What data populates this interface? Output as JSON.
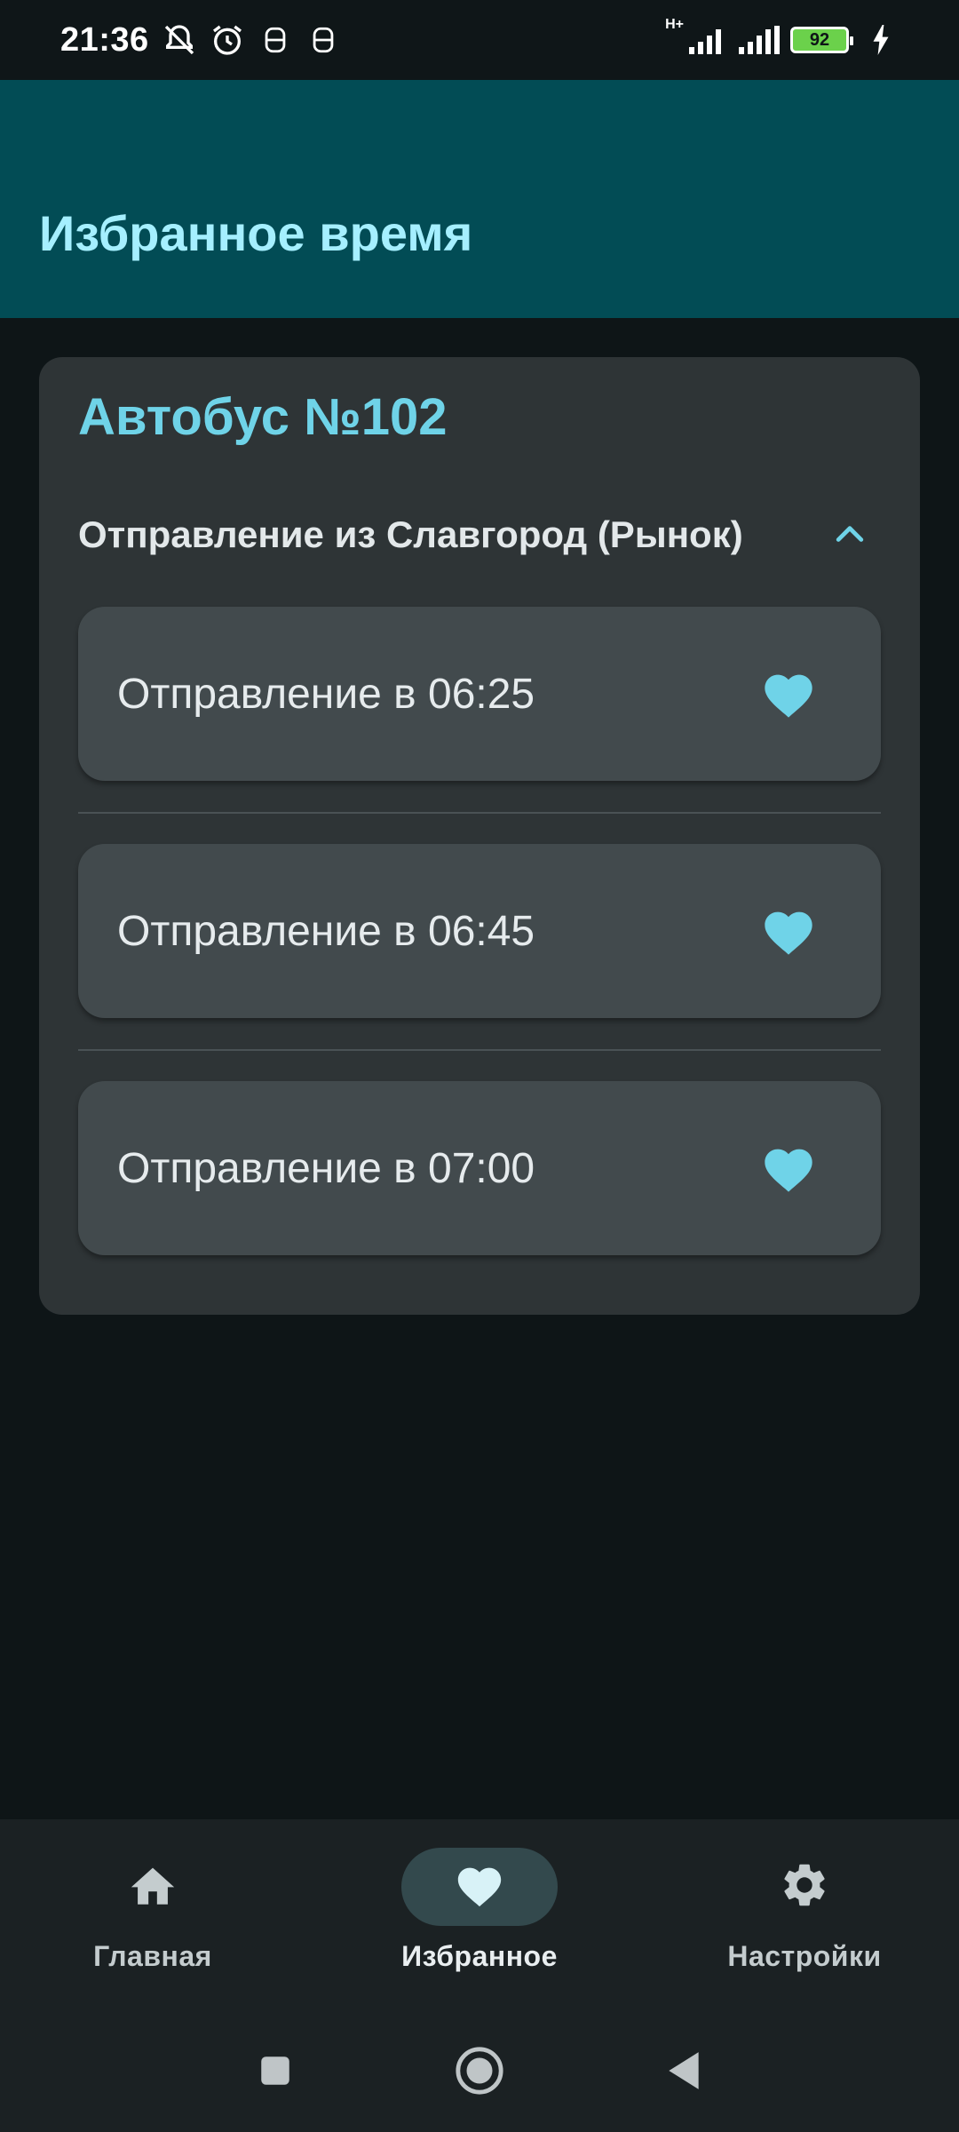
{
  "status_bar": {
    "time": "21:36",
    "network": "H+",
    "battery": "92"
  },
  "app_bar": {
    "title": "Избранное время"
  },
  "route": {
    "title": "Автобус №102",
    "direction": "Отправление из Славгород (Рынок)",
    "times": [
      {
        "label": "Отправление в 06:25",
        "favorite": true
      },
      {
        "label": "Отправление в 06:45",
        "favorite": true
      },
      {
        "label": "Отправление в 07:00",
        "favorite": true
      }
    ]
  },
  "bottom_nav": {
    "items": [
      {
        "label": "Главная",
        "icon": "home-icon",
        "active": false
      },
      {
        "label": "Избранное",
        "icon": "heart-icon",
        "active": true
      },
      {
        "label": "Настройки",
        "icon": "gear-icon",
        "active": false
      }
    ]
  },
  "colors": {
    "app_bar": "#024c55",
    "title_accent": "#a5efff",
    "route_accent": "#6fd3e8",
    "heart": "#6fd3e8",
    "card": "#2e3436",
    "item": "#424a4d",
    "background": "#0e1517"
  }
}
